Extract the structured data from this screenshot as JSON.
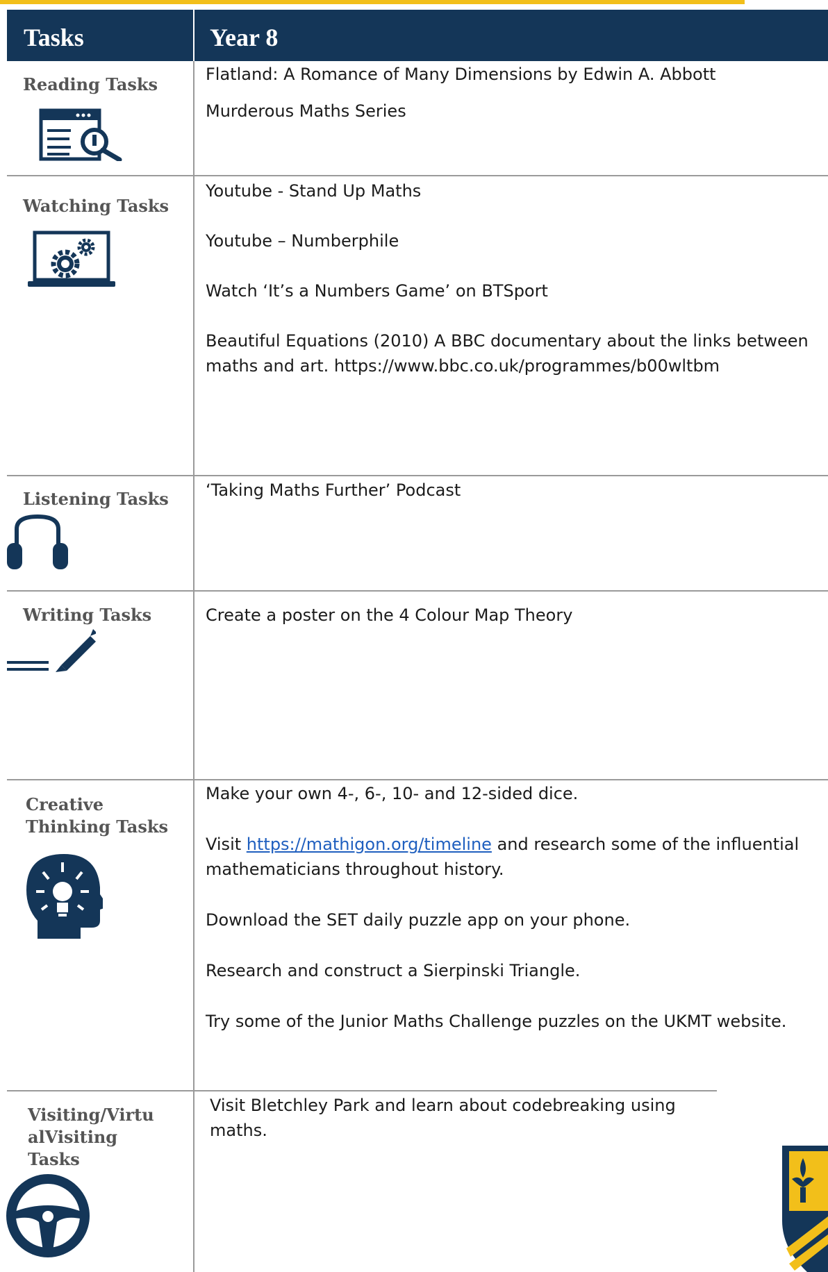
{
  "header": {
    "col1": "Tasks",
    "col2": "Year 8"
  },
  "colors": {
    "navy": "#143658",
    "accent_yellow": "#f2bf1a",
    "link": "#1f5fbf",
    "rule": "#9a9a9a"
  },
  "rows": [
    {
      "label": "Reading Tasks",
      "icon": "web-search-icon",
      "items": [
        "Flatland: A Romance of Many Dimensions by Edwin A. Abbott",
        "Murderous Maths Series"
      ]
    },
    {
      "label": "Watching Tasks",
      "icon": "laptop-settings-icon",
      "items": [
        "Youtube - Stand Up Maths",
        "Youtube – Numberphile",
        "Watch ‘It’s a Numbers Game’ on BTSport",
        "Beautiful Equations (2010) A BBC documentary about the links between maths and art. https://www.bbc.co.uk/programmes/b00wltbm"
      ]
    },
    {
      "label": "Listening Tasks",
      "icon": "headphones-icon",
      "items": [
        "‘Taking Maths Further’ Podcast"
      ]
    },
    {
      "label": "Writing Tasks",
      "icon": "pencil-icon",
      "items": [
        "Create a poster on the 4 Colour Map Theory"
      ]
    },
    {
      "label_line1": "Creative",
      "label_line2": "Thinking Tasks",
      "icon": "lightbulb-head-icon",
      "items": [
        "Make your own 4-, 6-, 10- and 12-sided dice."
      ],
      "visit_prefix": "Visit ",
      "visit_link": "https://mathigon.org/timeline",
      "visit_suffix": " and research some of the influential mathematicians throughout history.",
      "items_after": [
        "Download the SET daily puzzle app on your phone.",
        "Research and construct a Sierpinski Triangle.",
        "Try some of the Junior Maths Challenge puzzles on the UKMT website."
      ]
    },
    {
      "label_line1": "Visiting/Virtu",
      "label_line2": "alVisiting",
      "label_line3": "Tasks",
      "icon": "steering-wheel-icon",
      "items": [
        "Visit Bletchley Park and learn about codebreaking using maths."
      ]
    }
  ],
  "crest_icon": "school-crest-icon"
}
